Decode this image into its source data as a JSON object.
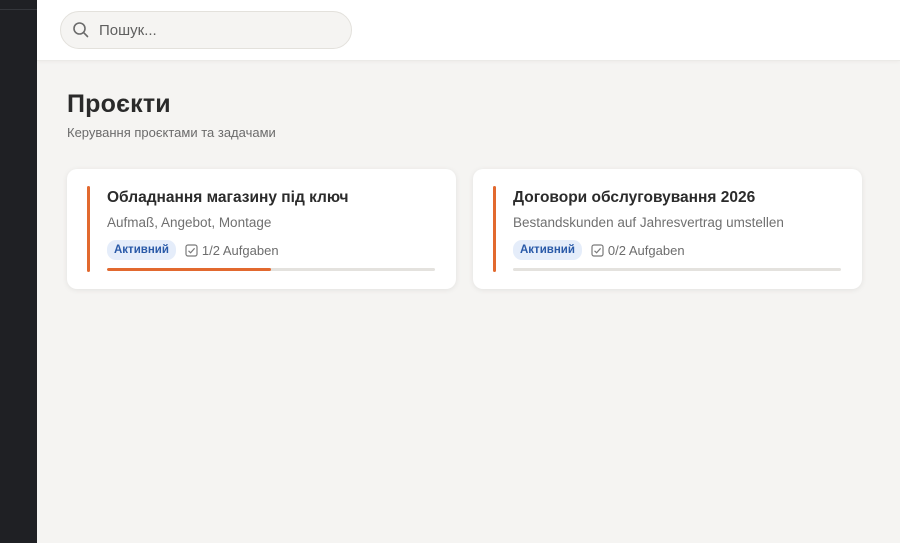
{
  "search": {
    "placeholder": "Пошук..."
  },
  "page": {
    "title": "Проєкти",
    "subtitle": "Керування проєктами та задачами"
  },
  "colors": {
    "accent": "#e2692f",
    "badge_bg": "#e5edfa",
    "badge_text": "#2a5aa8",
    "sidebar": "#1f2024"
  },
  "projects": [
    {
      "title": "Обладнання магазину під ключ",
      "description": "Aufmaß, Angebot, Montage",
      "status": "Активний",
      "tasks": "1/2 Aufgaben",
      "progress": 0.5
    },
    {
      "title": "Договори обслуговування 2026",
      "description": "Bestandskunden auf Jahresvertrag umstellen",
      "status": "Активний",
      "tasks": "0/2 Aufgaben",
      "progress": 0
    }
  ]
}
